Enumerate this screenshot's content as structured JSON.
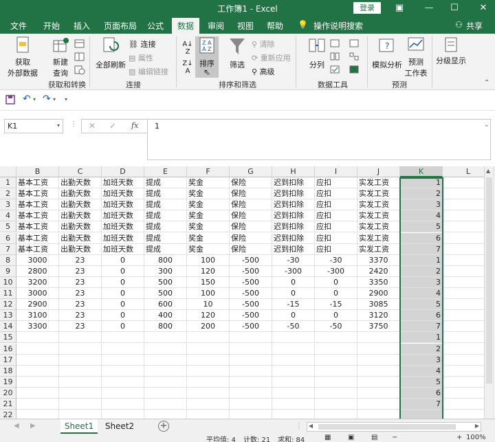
{
  "window": {
    "title": "工作簿1 - Excel",
    "login_label": "登录"
  },
  "tabs": [
    {
      "label": "文件",
      "active": false
    },
    {
      "label": "开始",
      "active": false
    },
    {
      "label": "插入",
      "active": false
    },
    {
      "label": "页面布局",
      "active": false
    },
    {
      "label": "公式",
      "active": false
    },
    {
      "label": "数据",
      "active": true
    },
    {
      "label": "审阅",
      "active": false
    },
    {
      "label": "视图",
      "active": false
    },
    {
      "label": "帮助",
      "active": false
    }
  ],
  "tell_me": "操作说明搜索",
  "share_label": "共享",
  "ribbon": {
    "get_data": {
      "line1": "获取",
      "line2": "外部数据"
    },
    "new_query": {
      "line1": "新建",
      "line2": "查询"
    },
    "group_get_transform": "获取和转换",
    "refresh_all": "全部刷新",
    "connections": "连接",
    "properties": "属性",
    "edit_links": "编辑链接",
    "group_connections": "连接",
    "sort": "排序",
    "filter": "筛选",
    "clear": "清除",
    "reapply": "重新应用",
    "advanced": "高级",
    "group_sort_filter": "排序和筛选",
    "split": "分列",
    "group_data_tools": "数据工具",
    "what_if": "模拟分析",
    "forecast_sheet": {
      "line1": "预测",
      "line2": "工作表"
    },
    "group_forecast": "预测",
    "outline": "分级显示"
  },
  "formula_bar": {
    "name_box": "K1",
    "fx": "fx",
    "value": "1"
  },
  "grid": {
    "columns": [
      "B",
      "C",
      "D",
      "E",
      "F",
      "G",
      "H",
      "I",
      "J",
      "K",
      "L"
    ],
    "rows": [
      [
        "基本工资",
        "出勤天数",
        "加班天数",
        "提成",
        "奖金",
        "保险",
        "迟到扣除",
        "应扣",
        "实发工资",
        "1"
      ],
      [
        "基本工资",
        "出勤天数",
        "加班天数",
        "提成",
        "奖金",
        "保险",
        "迟到扣除",
        "应扣",
        "实发工资",
        "2"
      ],
      [
        "基本工资",
        "出勤天数",
        "加班天数",
        "提成",
        "奖金",
        "保险",
        "迟到扣除",
        "应扣",
        "实发工资",
        "3"
      ],
      [
        "基本工资",
        "出勤天数",
        "加班天数",
        "提成",
        "奖金",
        "保险",
        "迟到扣除",
        "应扣",
        "实发工资",
        "4"
      ],
      [
        "基本工资",
        "出勤天数",
        "加班天数",
        "提成",
        "奖金",
        "保险",
        "迟到扣除",
        "应扣",
        "实发工资",
        "5"
      ],
      [
        "基本工资",
        "出勤天数",
        "加班天数",
        "提成",
        "奖金",
        "保险",
        "迟到扣除",
        "应扣",
        "实发工资",
        "6"
      ],
      [
        "基本工资",
        "出勤天数",
        "加班天数",
        "提成",
        "奖金",
        "保险",
        "迟到扣除",
        "应扣",
        "实发工资",
        "7"
      ],
      [
        "3000",
        "23",
        "0",
        "800",
        "100",
        "-500",
        "-30",
        "-30",
        "3370",
        "1"
      ],
      [
        "2800",
        "23",
        "0",
        "300",
        "120",
        "-500",
        "-300",
        "-300",
        "2420",
        "2"
      ],
      [
        "3200",
        "23",
        "0",
        "500",
        "150",
        "-500",
        "0",
        "0",
        "3350",
        "3"
      ],
      [
        "3000",
        "23",
        "0",
        "500",
        "100",
        "-500",
        "0",
        "0",
        "2900",
        "4"
      ],
      [
        "2900",
        "23",
        "0",
        "600",
        "10",
        "-500",
        "-15",
        "-15",
        "3085",
        "5"
      ],
      [
        "3100",
        "23",
        "0",
        "400",
        "120",
        "-500",
        "0",
        "0",
        "3120",
        "6"
      ],
      [
        "3300",
        "23",
        "0",
        "800",
        "200",
        "-500",
        "-50",
        "-50",
        "3750",
        "7"
      ],
      [
        "",
        "",
        "",
        "",
        "",
        "",
        "",
        "",
        "",
        "1"
      ],
      [
        "",
        "",
        "",
        "",
        "",
        "",
        "",
        "",
        "",
        "2"
      ],
      [
        "",
        "",
        "",
        "",
        "",
        "",
        "",
        "",
        "",
        "3"
      ],
      [
        "",
        "",
        "",
        "",
        "",
        "",
        "",
        "",
        "",
        "4"
      ],
      [
        "",
        "",
        "",
        "",
        "",
        "",
        "",
        "",
        "",
        "5"
      ],
      [
        "",
        "",
        "",
        "",
        "",
        "",
        "",
        "",
        "",
        "6"
      ],
      [
        "",
        "",
        "",
        "",
        "",
        "",
        "",
        "",
        "",
        "7"
      ],
      [
        "",
        "",
        "",
        "",
        "",
        "",
        "",
        "",
        "",
        ""
      ]
    ]
  },
  "sheets": [
    {
      "label": "Sheet1",
      "active": true
    },
    {
      "label": "Sheet2",
      "active": false
    }
  ],
  "status": {
    "average": "平均值: 4",
    "count": "计数: 21",
    "sum": "求和: 84",
    "zoom": "100%"
  },
  "colors": {
    "accent": "#217346",
    "selection": "#d4d4d4"
  }
}
